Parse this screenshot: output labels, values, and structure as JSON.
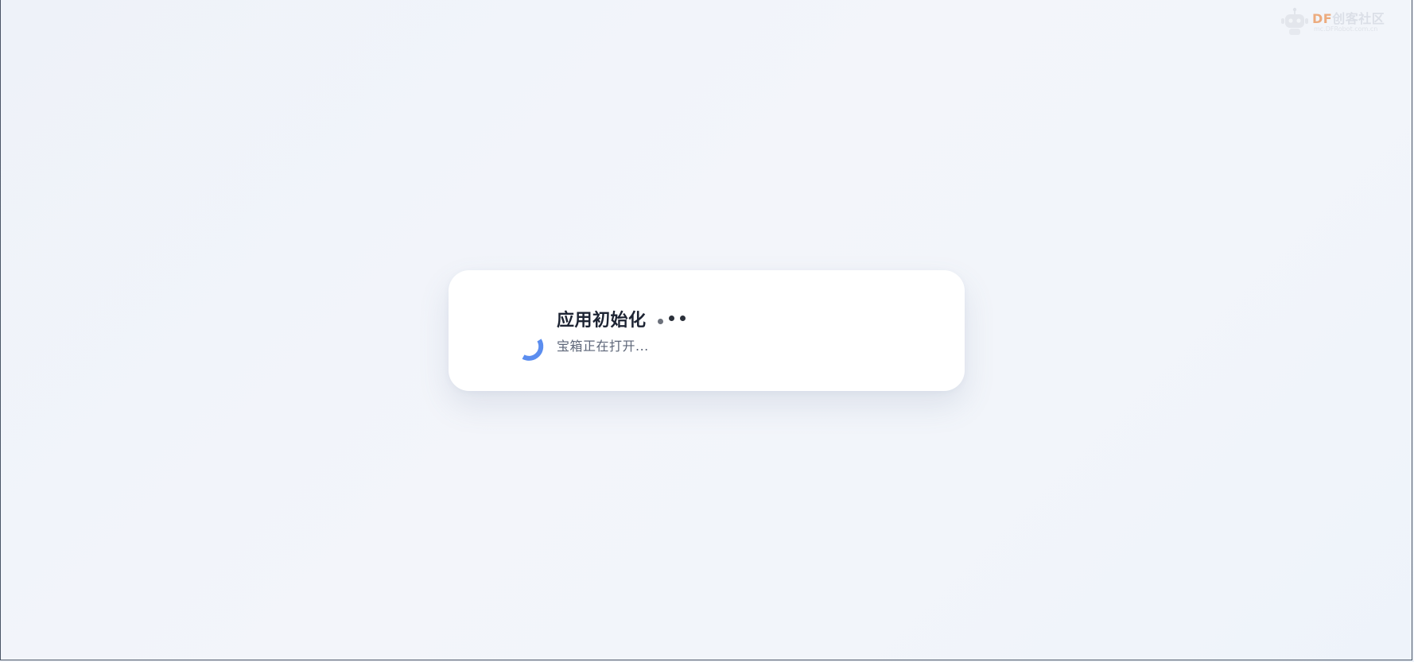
{
  "watermark": {
    "brand_latin": "DF",
    "brand_cn": "创客社区",
    "url": "mc.DFRobot.com.cn"
  },
  "loading": {
    "title": "应用初始化",
    "subtitle": "宝箱正在打开..."
  },
  "colors": {
    "spinner": "#5b8def",
    "title": "#1d2433",
    "subtitle": "#5d6678",
    "brand_accent": "#e8701a"
  },
  "icons": {
    "spinner": "loading-spinner-icon",
    "dots": "typing-dots-icon",
    "robot": "robot-logo-icon"
  }
}
